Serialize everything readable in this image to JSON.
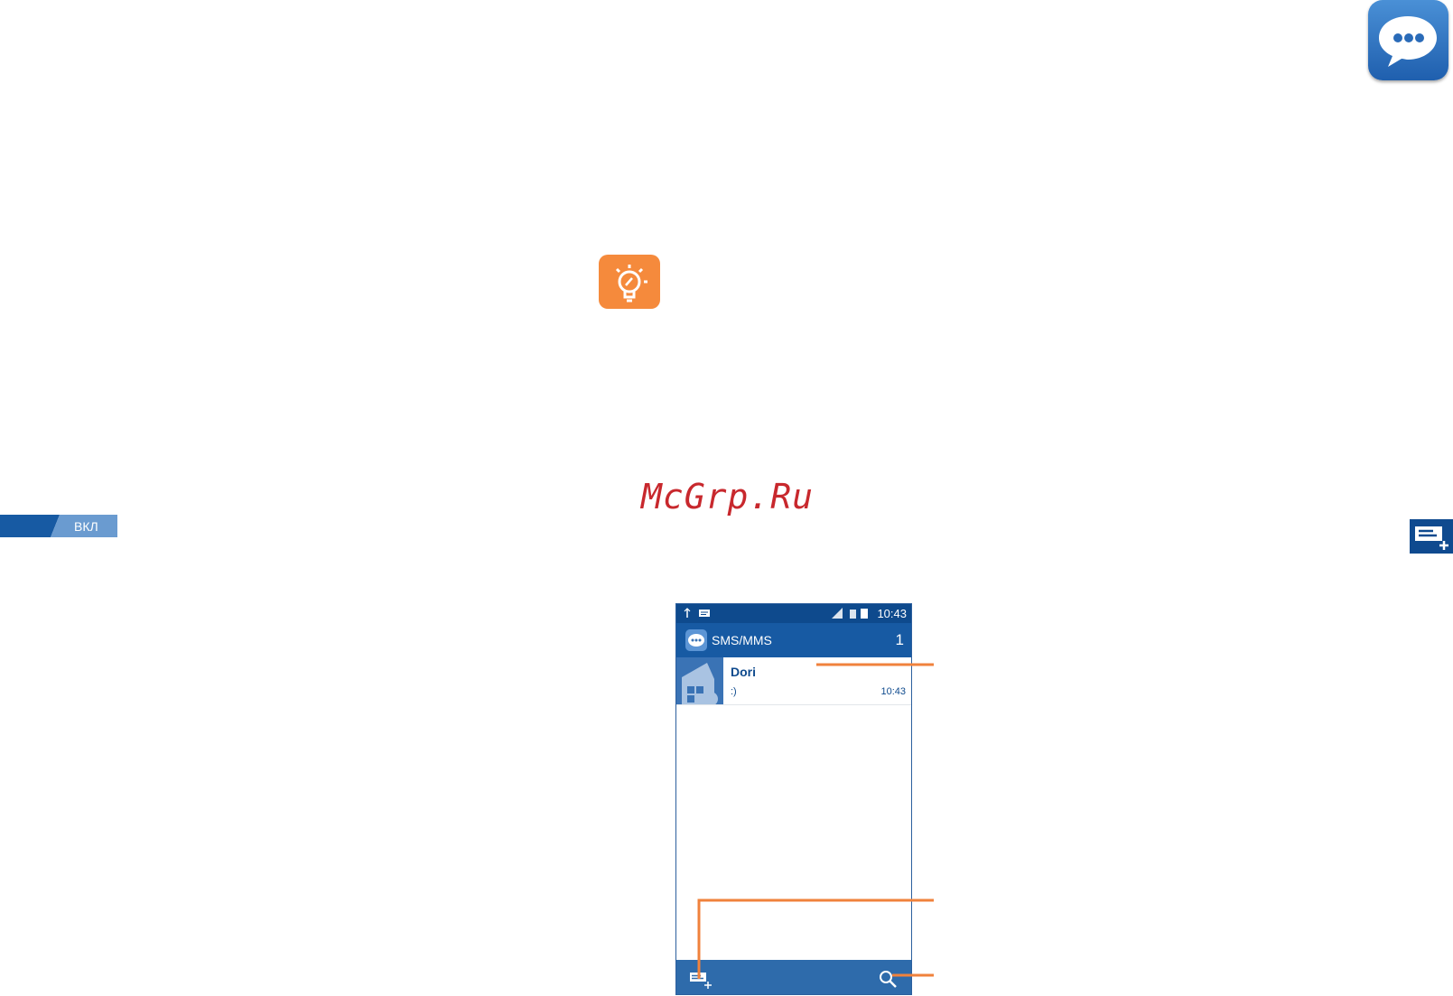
{
  "watermark": "McGrp.Ru",
  "tab": {
    "label": "ВКЛ"
  },
  "phone": {
    "status_time": "10:43",
    "app_title": "SMS/MMS",
    "unread_count": "1",
    "conversation": {
      "name": "Dori",
      "snippet": ":)",
      "time": "10:43"
    }
  },
  "icons": {
    "app": "messaging-app-icon",
    "tip": "lightbulb-tip-icon",
    "compose": "new-message-icon",
    "search": "search-icon"
  },
  "colors": {
    "accent_blue": "#175aa3",
    "callout_orange": "#f0823c",
    "watermark_red": "#c8282d",
    "tip_orange": "#f58a3c"
  }
}
